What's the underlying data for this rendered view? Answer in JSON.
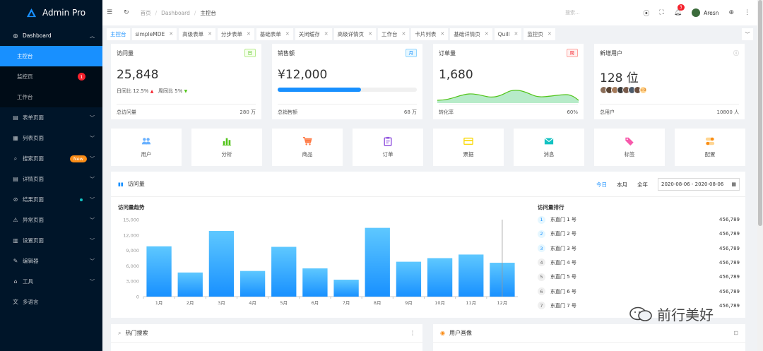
{
  "app": {
    "title": "Admin Pro"
  },
  "sidebar": {
    "dashboard": "Dashboard",
    "sub": [
      {
        "label": "主控台"
      },
      {
        "label": "监控页",
        "badge": "1"
      },
      {
        "label": "工作台"
      }
    ],
    "items": [
      {
        "label": "表单页面",
        "icon": "form-icon"
      },
      {
        "label": "列表页面",
        "icon": "list-icon"
      },
      {
        "label": "搜索页面",
        "icon": "search-icon",
        "badge": "New"
      },
      {
        "label": "详情页面",
        "icon": "detail-icon"
      },
      {
        "label": "结果页面",
        "icon": "result-icon"
      },
      {
        "label": "异常页面",
        "icon": "warning-icon"
      },
      {
        "label": "设置页面",
        "icon": "settings-icon"
      },
      {
        "label": "编辑器",
        "icon": "editor-icon"
      },
      {
        "label": "工具",
        "icon": "tool-icon"
      },
      {
        "label": "多语言",
        "icon": "language-icon"
      }
    ]
  },
  "header": {
    "breadcrumb": [
      "首页",
      "Dashboard",
      "主控台"
    ],
    "search_placeholder": "搜索...",
    "notif_count": "3",
    "user": "Aresn"
  },
  "tabs": [
    "主控台",
    "simpleMDE",
    "高级表单",
    "分步表单",
    "基础表单",
    "关闭缓存",
    "高级详情页",
    "工作台",
    "卡片列表",
    "基础详情页",
    "Quill",
    "监控页"
  ],
  "stats": [
    {
      "title": "访问量",
      "tag": "日",
      "value": "25,848",
      "sub1": "日同比 12.5%",
      "sub2": "周同比 5%",
      "foot_label": "总访问量",
      "foot_value": "280 万"
    },
    {
      "title": "销售额",
      "tag": "月",
      "value": "¥12,000",
      "progress": 0.6,
      "foot_label": "总销售额",
      "foot_value": "68 万"
    },
    {
      "title": "订单量",
      "tag": "周",
      "value": "1,680",
      "foot_label": "转化率",
      "foot_value": "60%"
    },
    {
      "title": "新增用户",
      "value": "128 位",
      "more": "+9",
      "foot_label": "总用户",
      "foot_value": "10800 人"
    }
  ],
  "quick": [
    {
      "label": "用户",
      "icon": "users-icon",
      "color": "#69b1ff"
    },
    {
      "label": "分析",
      "icon": "analysis-icon",
      "color": "#52c41a"
    },
    {
      "label": "商品",
      "icon": "cart-icon",
      "color": "#ff7a45"
    },
    {
      "label": "订单",
      "icon": "clipboard-icon",
      "color": "#9254de"
    },
    {
      "label": "票据",
      "icon": "card-icon",
      "color": "#fadb14"
    },
    {
      "label": "消息",
      "icon": "mail-icon",
      "color": "#13c2c2"
    },
    {
      "label": "标签",
      "icon": "tag-icon",
      "color": "#f759ab"
    },
    {
      "label": "配置",
      "icon": "config-icon",
      "color": "#fa8c16"
    }
  ],
  "visits": {
    "title": "访问量",
    "ranges": [
      "今日",
      "本月",
      "全年"
    ],
    "date_range": "2020-08-06 - 2020-08-06",
    "rank_title": "访问量排行",
    "ranks": [
      {
        "n": "1",
        "name": "东直门 1 号",
        "value": "456,789"
      },
      {
        "n": "2",
        "name": "东直门 2 号",
        "value": "456,789"
      },
      {
        "n": "3",
        "name": "东直门 3 号",
        "value": "456,789"
      },
      {
        "n": "4",
        "name": "东直门 4 号",
        "value": "456,789"
      },
      {
        "n": "5",
        "name": "东直门 5 号",
        "value": "456,789"
      },
      {
        "n": "6",
        "name": "东直门 6 号",
        "value": "456,789"
      },
      {
        "n": "7",
        "name": "东直门 7 号",
        "value": "456,789"
      }
    ]
  },
  "chart_data": {
    "type": "bar",
    "title": "访问量趋势",
    "categories": [
      "1月",
      "2月",
      "3月",
      "4月",
      "5月",
      "6月",
      "7月",
      "8月",
      "9月",
      "10月",
      "11月",
      "12月"
    ],
    "values": [
      9800,
      4700,
      12800,
      5000,
      9700,
      5500,
      3300,
      13400,
      6800,
      7500,
      8200,
      6600
    ],
    "yticks": [
      0,
      3000,
      6000,
      9000,
      12000,
      15000
    ],
    "ytick_labels": [
      "0",
      "3,000",
      "6,000",
      "9,000",
      "12,000",
      "15,000"
    ],
    "ylim": [
      0,
      15000
    ],
    "xlabel": "",
    "ylabel": "",
    "grid": false,
    "color": "#1890ff"
  },
  "bottom": {
    "left": "热门搜索",
    "right": "用户画像"
  },
  "watermark": "前行美好"
}
